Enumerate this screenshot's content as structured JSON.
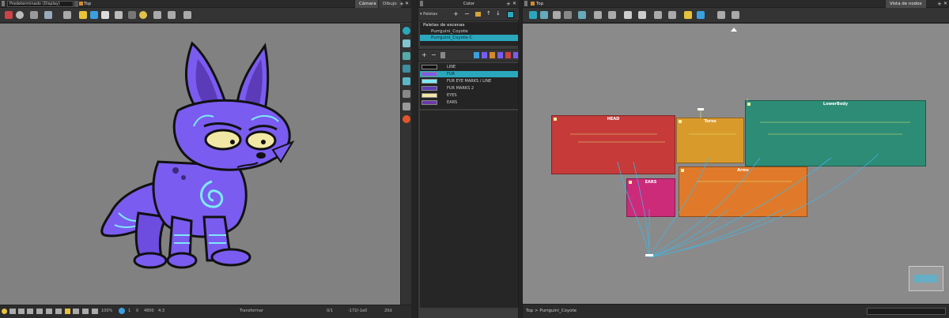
{
  "camera": {
    "preset_dropdown": "Predeterminado (Display)",
    "scene_label": "Top",
    "tabs": [
      "Cámara",
      "Dibujo"
    ],
    "status": {
      "zoom": "100%",
      "frame_a": "1",
      "frame_b": "0",
      "fov": "4800",
      "aspect": "4:3",
      "mode": "Transformar",
      "coord_a": "0/1",
      "coord_b": "-172/-1e0",
      "pct": "20d"
    }
  },
  "color_panel": {
    "title": "Color",
    "palettes_label": "Paletas",
    "scene_palettes_label": "Paletas de escenas",
    "palettes": [
      {
        "name": "Purrguini_Coyote",
        "selected": false
      },
      {
        "name": "Purrguini_Coyote-C",
        "selected": true
      }
    ],
    "swatches": [
      {
        "name": "LINE",
        "color": "#111111",
        "selected": false
      },
      {
        "name": "FUR",
        "color": "#7a5cf0",
        "selected": true
      },
      {
        "name": "FUR EYE MARKS / LINE",
        "color": "#7fe8f5",
        "selected": false
      },
      {
        "name": "FUR MARKS 2",
        "color": "#5b3bb8",
        "selected": false
      },
      {
        "name": "EYES",
        "color": "#f2e8a6",
        "selected": false
      },
      {
        "name": "EARS",
        "color": "#6c3aa8",
        "selected": false
      }
    ]
  },
  "node_view": {
    "scene_label": "Top",
    "tab_label": "Vista de nodos",
    "breadcrumb_root": "Top",
    "breadcrumb_current": "Purrguini_Coyote",
    "groups": [
      {
        "name": "HEAD",
        "color": "#c63a3a"
      },
      {
        "name": "Torso",
        "color": "#d99a2c"
      },
      {
        "name": "LowerBody",
        "color": "#2d8c76"
      },
      {
        "name": "Arms",
        "color": "#e07a2a"
      },
      {
        "name": "EARS",
        "color": "#cc2b7a"
      }
    ]
  },
  "colors": {
    "accent": "#2aa7bd",
    "viewport_bg": "#818181",
    "node_bg": "#8a8a8a"
  }
}
